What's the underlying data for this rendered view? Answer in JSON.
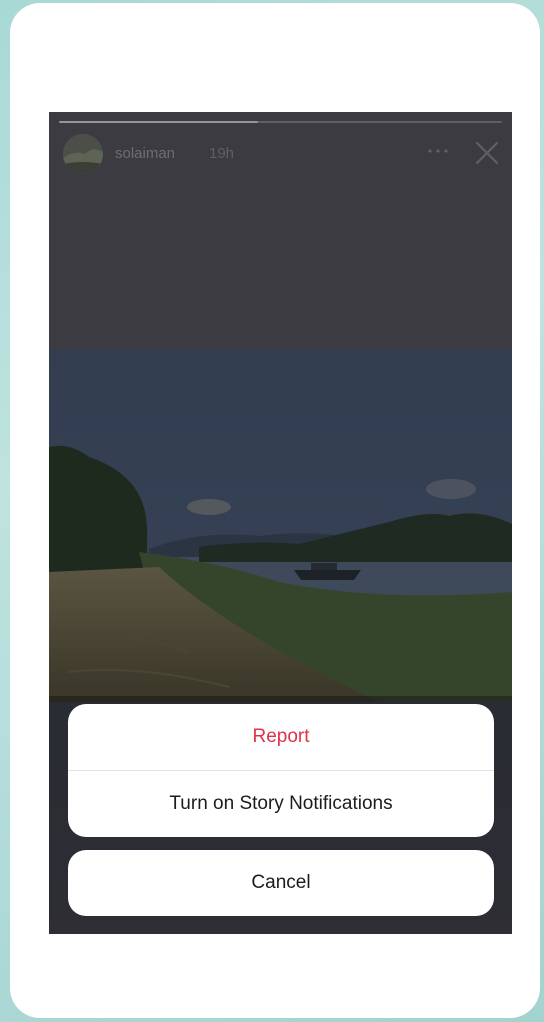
{
  "story": {
    "username": "solaiman",
    "timestamp": "19h",
    "progress": 0.45
  },
  "icons": {
    "more": "more-icon",
    "close": "close-icon"
  },
  "action_sheet": {
    "report_label": "Report",
    "notifications_label": "Turn on Story Notifications",
    "cancel_label": "Cancel"
  },
  "colors": {
    "destructive": "#e0314d",
    "background": "#a9d9d5"
  }
}
